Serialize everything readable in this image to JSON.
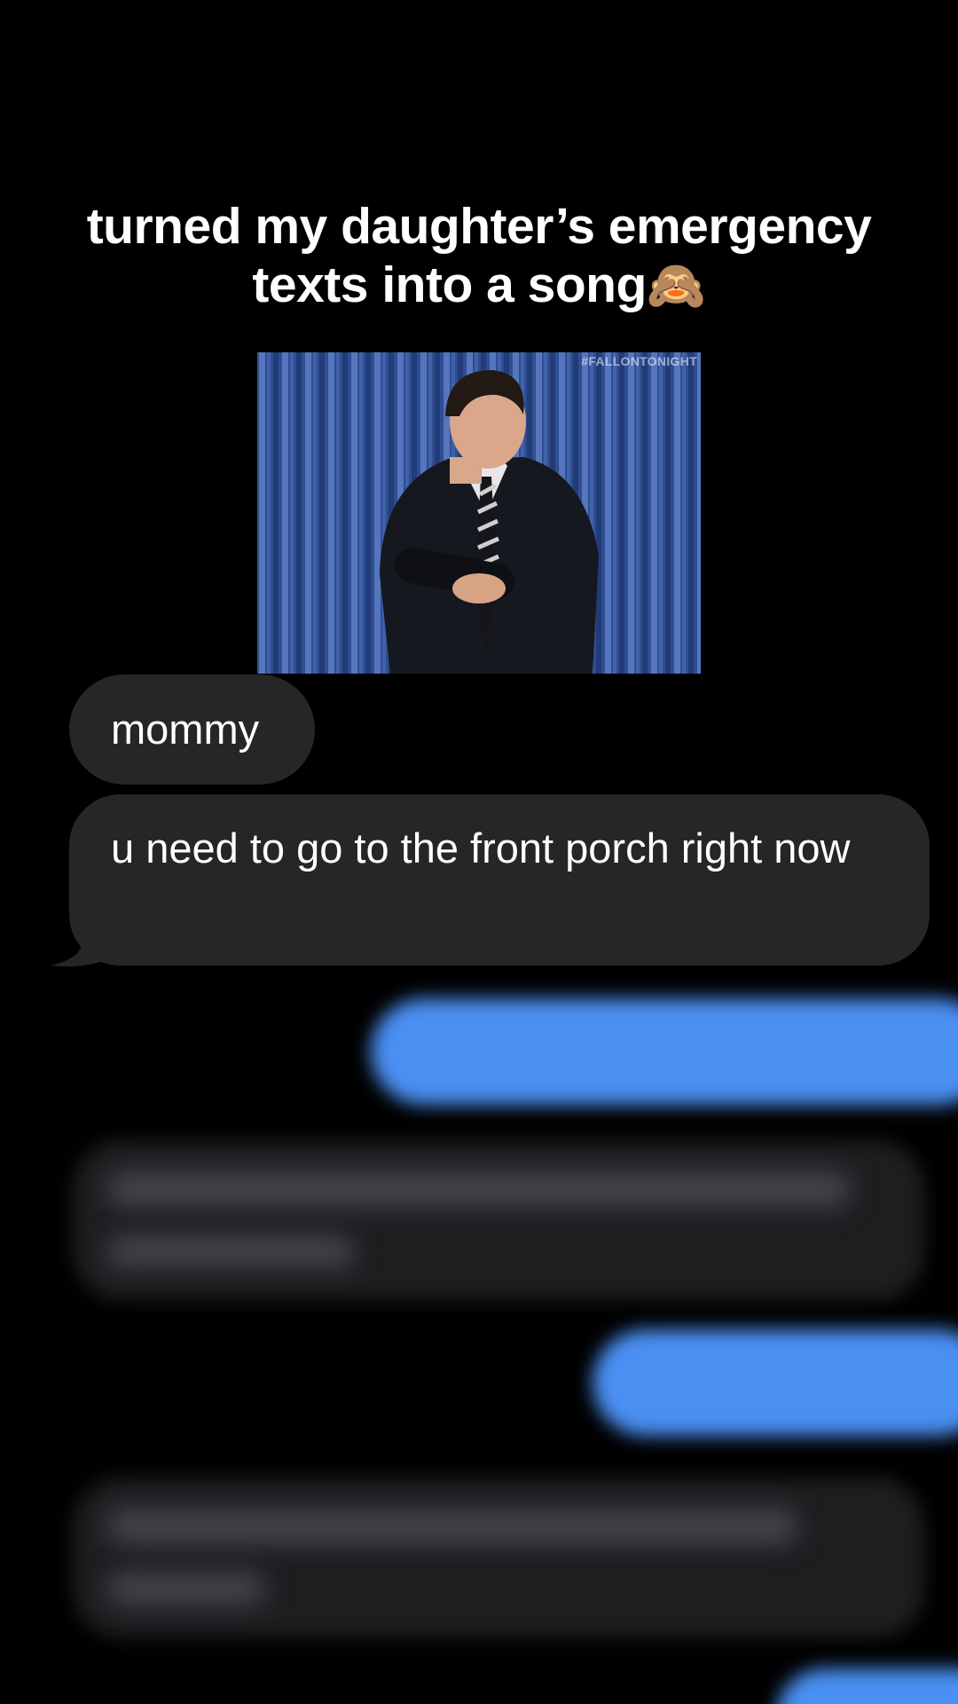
{
  "caption": {
    "line1": "turned my daughter’s emergency",
    "line2": "texts into a song",
    "emoji": "🙈",
    "emoji_icon": "see-no-evil-monkey-icon"
  },
  "gif": {
    "watermark": "#FALLONTONIGHT"
  },
  "messages": [
    {
      "direction": "incoming",
      "text": "mommy"
    },
    {
      "direction": "incoming",
      "text": "u need to go to the front porch right now"
    }
  ],
  "colors": {
    "background": "#000000",
    "incoming_bubble": "#262629",
    "outgoing_bubble": "#4a8ff2",
    "text": "#ffffff"
  }
}
